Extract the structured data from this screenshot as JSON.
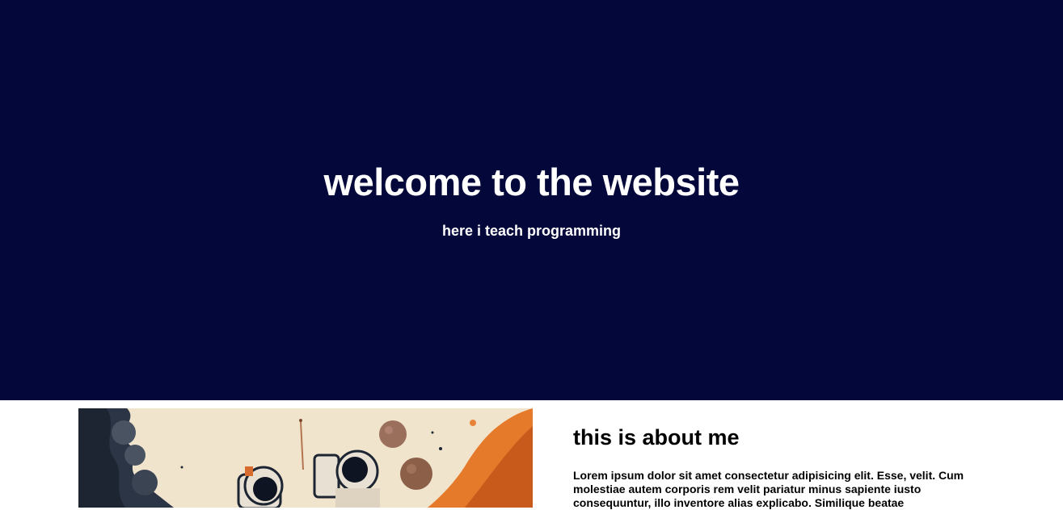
{
  "hero": {
    "title": "welcome to the website",
    "subtitle": "here i teach programming",
    "background_color": "#03073a"
  },
  "about": {
    "image_icon": "astronaut-illustration",
    "title": "this is about me",
    "text": "Lorem ipsum dolor sit amet consectetur adipisicing elit. Esse, velit. Cum molestiae autem corporis rem velit pariatur minus sapiente iusto consequuntur, illo inventore alias explicabo. Similique beatae"
  }
}
